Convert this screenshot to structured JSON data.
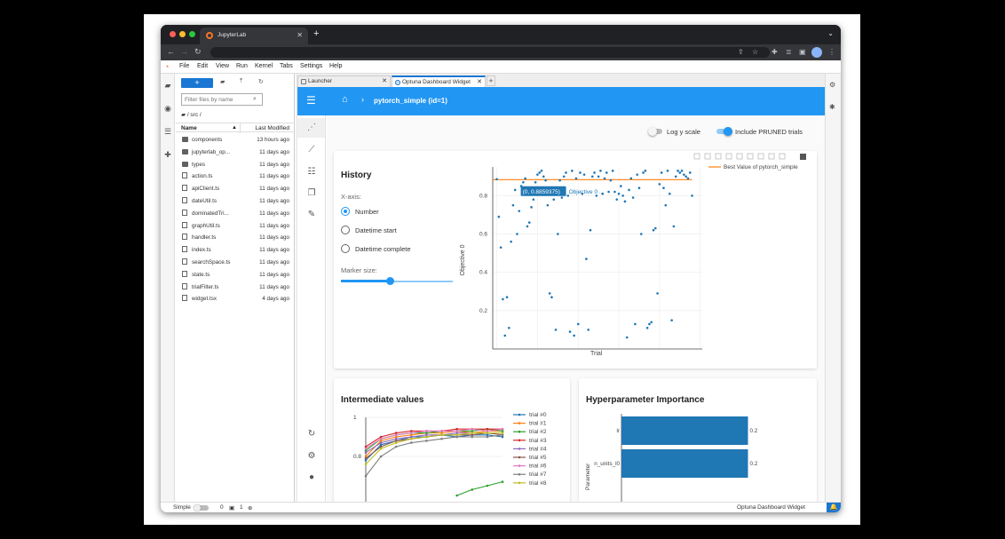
{
  "browser": {
    "tab_title": "JupyterLab",
    "new_tab_glyph": "+"
  },
  "menubar": {
    "items": [
      "File",
      "Edit",
      "View",
      "Run",
      "Kernel",
      "Tabs",
      "Settings",
      "Help"
    ]
  },
  "filebrowser": {
    "new_label": "+",
    "filter_placeholder": "Filter files by name",
    "breadcrumb": "/ src /",
    "col_name": "Name",
    "col_modified": "Last Modified",
    "rows": [
      {
        "name": "components",
        "modified": "13 hours ago",
        "kind": "folder"
      },
      {
        "name": "jupyterlab_op...",
        "modified": "11 days ago",
        "kind": "folder"
      },
      {
        "name": "types",
        "modified": "11 days ago",
        "kind": "folder"
      },
      {
        "name": "action.ts",
        "modified": "11 days ago",
        "kind": "file"
      },
      {
        "name": "apiClient.ts",
        "modified": "11 days ago",
        "kind": "file"
      },
      {
        "name": "dateUtil.ts",
        "modified": "11 days ago",
        "kind": "file"
      },
      {
        "name": "dominatedTri...",
        "modified": "11 days ago",
        "kind": "file"
      },
      {
        "name": "graphUtil.ts",
        "modified": "11 days ago",
        "kind": "file"
      },
      {
        "name": "handler.ts",
        "modified": "11 days ago",
        "kind": "file"
      },
      {
        "name": "index.ts",
        "modified": "11 days ago",
        "kind": "file"
      },
      {
        "name": "searchSpace.ts",
        "modified": "11 days ago",
        "kind": "file"
      },
      {
        "name": "state.ts",
        "modified": "11 days ago",
        "kind": "file"
      },
      {
        "name": "trialFilter.ts",
        "modified": "11 days ago",
        "kind": "file"
      },
      {
        "name": "widget.tsx",
        "modified": "4 days ago",
        "kind": "file"
      }
    ]
  },
  "doc_tabs": [
    {
      "label": "Launcher",
      "active": false
    },
    {
      "label": "Optuna Dashboard Widget",
      "active": true
    }
  ],
  "dashboard": {
    "breadcrumb_title": "pytorch_simple (id=1)",
    "toggle_log_label": "Log y scale",
    "toggle_log_on": false,
    "toggle_pruned_label": "Include PRUNED trials",
    "toggle_pruned_on": true,
    "history": {
      "title": "History",
      "xaxis_label": "X-axis:",
      "options": [
        "Number",
        "Datetime start",
        "Datetime complete"
      ],
      "selected": "Number",
      "marker_label": "Marker size:",
      "marker_fraction": 0.44,
      "tooltip_value": "(0, 0.8859375)",
      "tooltip_name": "Objective 0 ..."
    },
    "intermediate_title": "Intermediate values",
    "importance_title": "Hyperparameter Importance"
  },
  "statusbar": {
    "mode": "Simple",
    "kernels": "0",
    "terminals": "1",
    "right_label": "Optuna Dashboard Widget"
  },
  "colors": {
    "accent": "#2196f3",
    "jupyter_orange": "#f37626",
    "bar": "#1f77b4",
    "best_line": "#ff7f0e"
  },
  "chart_data": [
    {
      "type": "scatter",
      "title": "",
      "xlabel": "Trial",
      "ylabel": "Objective 0",
      "ylim": [
        0,
        0.95
      ],
      "yticks": [
        0.2,
        0.4,
        0.6,
        0.8
      ],
      "xlim": [
        -2,
        101
      ],
      "legend": [
        "Best Value of pytorch_simple"
      ],
      "legend_position": "top-right",
      "best_value": 0.886,
      "series": [
        {
          "name": "Objective 0",
          "points": [
            [
              0,
              0.886
            ],
            [
              1,
              0.69
            ],
            [
              2,
              0.53
            ],
            [
              3,
              0.26
            ],
            [
              4,
              0.07
            ],
            [
              5,
              0.27
            ],
            [
              6,
              0.11
            ],
            [
              7,
              0.56
            ],
            [
              8,
              0.75
            ],
            [
              9,
              0.83
            ],
            [
              10,
              0.6
            ],
            [
              11,
              0.72
            ],
            [
              12,
              0.85
            ],
            [
              13,
              0.87
            ],
            [
              14,
              0.89
            ],
            [
              15,
              0.64
            ],
            [
              16,
              0.66
            ],
            [
              17,
              0.74
            ],
            [
              18,
              0.78
            ],
            [
              19,
              0.87
            ],
            [
              20,
              0.91
            ],
            [
              21,
              0.92
            ],
            [
              22,
              0.93
            ],
            [
              23,
              0.9
            ],
            [
              24,
              0.88
            ],
            [
              25,
              0.75
            ],
            [
              26,
              0.29
            ],
            [
              27,
              0.27
            ],
            [
              28,
              0.78
            ],
            [
              29,
              0.1
            ],
            [
              30,
              0.6
            ],
            [
              31,
              0.88
            ],
            [
              32,
              0.79
            ],
            [
              33,
              0.9
            ],
            [
              34,
              0.92
            ],
            [
              35,
              0.8
            ],
            [
              36,
              0.09
            ],
            [
              37,
              0.93
            ],
            [
              38,
              0.07
            ],
            [
              39,
              0.89
            ],
            [
              40,
              0.13
            ],
            [
              41,
              0.92
            ],
            [
              42,
              0.81
            ],
            [
              43,
              0.91
            ],
            [
              44,
              0.47
            ],
            [
              45,
              0.1
            ],
            [
              46,
              0.62
            ],
            [
              47,
              0.9
            ],
            [
              48,
              0.92
            ],
            [
              49,
              0.8
            ],
            [
              50,
              0.9
            ],
            [
              51,
              0.93
            ],
            [
              52,
              0.81
            ],
            [
              53,
              0.89
            ],
            [
              54,
              0.92
            ],
            [
              55,
              0.82
            ],
            [
              56,
              0.88
            ],
            [
              57,
              0.93
            ],
            [
              58,
              0.82
            ],
            [
              59,
              0.78
            ],
            [
              60,
              0.81
            ],
            [
              61,
              0.85
            ],
            [
              62,
              0.8
            ],
            [
              63,
              0.77
            ],
            [
              64,
              0.06
            ],
            [
              65,
              0.83
            ],
            [
              66,
              0.89
            ],
            [
              67,
              0.79
            ],
            [
              68,
              0.13
            ],
            [
              69,
              0.91
            ],
            [
              70,
              0.84
            ],
            [
              71,
              0.6
            ],
            [
              72,
              0.92
            ],
            [
              73,
              0.93
            ],
            [
              74,
              0.11
            ],
            [
              75,
              0.13
            ],
            [
              76,
              0.14
            ],
            [
              77,
              0.62
            ],
            [
              78,
              0.63
            ],
            [
              79,
              0.29
            ],
            [
              80,
              0.86
            ],
            [
              81,
              0.92
            ],
            [
              82,
              0.84
            ],
            [
              83,
              0.75
            ],
            [
              84,
              0.93
            ],
            [
              85,
              0.81
            ],
            [
              86,
              0.15
            ],
            [
              87,
              0.64
            ],
            [
              88,
              0.9
            ],
            [
              89,
              0.93
            ],
            [
              90,
              0.92
            ],
            [
              91,
              0.93
            ],
            [
              92,
              0.91
            ],
            [
              93,
              0.9
            ],
            [
              94,
              0.89
            ],
            [
              95,
              0.92
            ],
            [
              96,
              0.8
            ]
          ]
        }
      ]
    },
    {
      "type": "line",
      "title": "Intermediate values",
      "ylim": [
        0.6,
        1.0
      ],
      "yticks": [
        0.8,
        1
      ],
      "x": [
        0,
        1,
        2,
        3,
        4,
        5,
        6,
        7,
        8,
        9
      ],
      "legend_position": "right",
      "series": [
        {
          "name": "trial #0",
          "color": "#1f77b4",
          "values": [
            0.78,
            0.86,
            0.88,
            0.9,
            0.9,
            0.91,
            0.9,
            0.91,
            0.91,
            0.9
          ]
        },
        {
          "name": "trial #1",
          "color": "#ff7f0e",
          "values": [
            0.8,
            0.88,
            0.9,
            0.91,
            0.92,
            0.92,
            0.93,
            0.92,
            0.93,
            0.93
          ]
        },
        {
          "name": "trial #2",
          "color": "#2ca02c",
          "values": [
            0.83,
            0.89,
            0.91,
            0.92,
            0.92,
            0.93,
            0.93,
            0.93,
            0.94,
            0.93
          ]
        },
        {
          "name": "trial #3",
          "color": "#d62728",
          "values": [
            0.85,
            0.9,
            0.92,
            0.93,
            0.93,
            0.93,
            0.94,
            0.94,
            0.94,
            0.94
          ]
        },
        {
          "name": "trial #4",
          "color": "#9467bd",
          "values": [
            0.82,
            0.87,
            0.89,
            0.9,
            0.91,
            0.91,
            0.92,
            0.92,
            0.92,
            0.92
          ]
        },
        {
          "name": "trial #5",
          "color": "#8c564b",
          "values": [
            0.79,
            0.85,
            0.88,
            0.89,
            0.9,
            0.91,
            0.91,
            0.91,
            0.92,
            0.91
          ]
        },
        {
          "name": "trial #6",
          "color": "#e377c2",
          "values": [
            0.84,
            0.89,
            0.91,
            0.92,
            0.93,
            0.93,
            0.93,
            0.94,
            0.93,
            0.94
          ]
        },
        {
          "name": "trial #7",
          "color": "#7f7f7f",
          "values": [
            0.7,
            0.8,
            0.85,
            0.87,
            0.88,
            0.89,
            0.9,
            0.9,
            0.9,
            0.91
          ]
        },
        {
          "name": "trial #8",
          "color": "#bcbd22",
          "values": [
            0.76,
            0.84,
            0.87,
            0.89,
            0.9,
            0.91,
            0.91,
            0.92,
            0.92,
            0.92
          ]
        },
        {
          "name": "",
          "color": "#2ca02c",
          "values": [
            null,
            null,
            null,
            null,
            null,
            null,
            0.6,
            0.63,
            0.65,
            0.67
          ]
        }
      ]
    },
    {
      "type": "bar",
      "orientation": "horizontal",
      "title": "Hyperparameter Importance",
      "categories": [
        "lr",
        "n_units_l0"
      ],
      "values": [
        0.2,
        0.2
      ],
      "value_labels": [
        "0.2",
        "0.2"
      ],
      "xlim": [
        0,
        0.24
      ],
      "ylabel": "Parameter"
    }
  ]
}
